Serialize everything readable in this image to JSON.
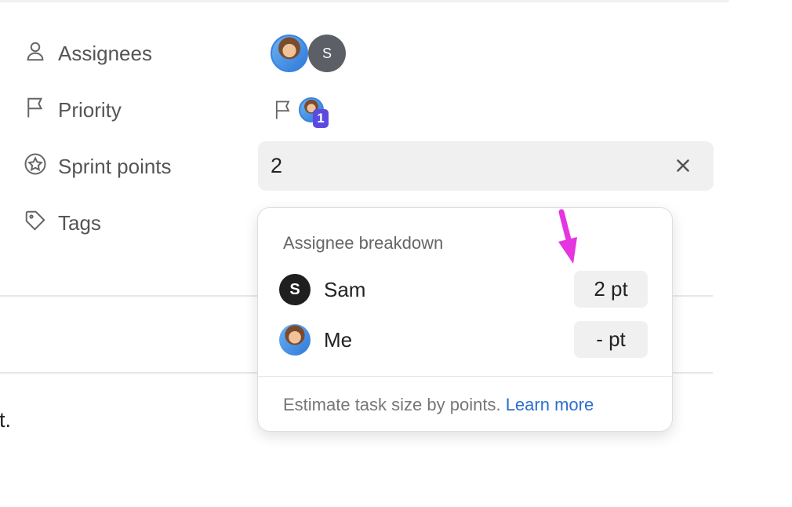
{
  "properties": {
    "assignees": {
      "label": "Assignees",
      "avatar_initial": "S"
    },
    "priority": {
      "label": "Priority",
      "badge": "1"
    },
    "sprint_points": {
      "label": "Sprint points",
      "value": "2"
    },
    "tags": {
      "label": "Tags"
    }
  },
  "popup": {
    "title": "Assignee breakdown",
    "rows": [
      {
        "initial": "S",
        "name": "Sam",
        "points": "2 pt"
      },
      {
        "name": "Me",
        "points": "- pt"
      }
    ],
    "footer_text": "Estimate task size by points.",
    "footer_link": "Learn more"
  },
  "body_fragment": "t.",
  "colors": {
    "accent_link": "#2d6fd0",
    "priority_badge": "#5b4ae0",
    "annotation_arrow": "#e535e0",
    "avatar_gray": "#5c5f66"
  }
}
